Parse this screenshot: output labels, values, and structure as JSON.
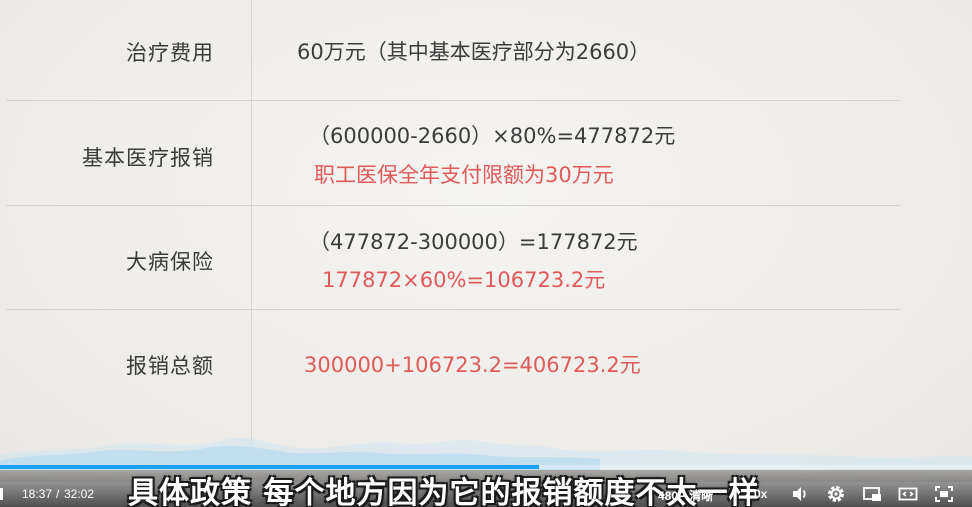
{
  "slide": {
    "rows": [
      {
        "label": "治疗费用",
        "lines": [
          {
            "text": "60万元（其中基本医疗部分为2660）",
            "color": "dark"
          }
        ]
      },
      {
        "label": "基本医疗报销",
        "lines": [
          {
            "text": "（600000-2660）×80%=477872元",
            "color": "dark"
          },
          {
            "text": "职工医保全年支付限额为30万元",
            "color": "red"
          }
        ]
      },
      {
        "label": "大病保险",
        "lines": [
          {
            "text": "（477872-300000）=177872元",
            "color": "dark"
          },
          {
            "text": "177872×60%=106723.2元",
            "color": "red"
          }
        ]
      },
      {
        "label": "报销总额",
        "lines": [
          {
            "text": "300000+106723.2=406723.2元",
            "color": "red"
          }
        ]
      }
    ]
  },
  "subtitle": "具体政策 每个地方因为它的报销额度不太一样",
  "player": {
    "current_time": "18:37",
    "separator": "/",
    "duration": "32:02",
    "progress_fraction": 0.555,
    "quality_label": "480P 清晰",
    "speed_label": "2.0x",
    "icons": [
      "volume-icon",
      "settings-icon",
      "pip-icon",
      "widescreen-icon",
      "fullscreen-icon"
    ],
    "accent_color": "#1aa0f0"
  },
  "colors": {
    "dark_text": "#3c3c3c",
    "red_text": "#e05a5a",
    "mountain_blue": "#bcdcef"
  }
}
